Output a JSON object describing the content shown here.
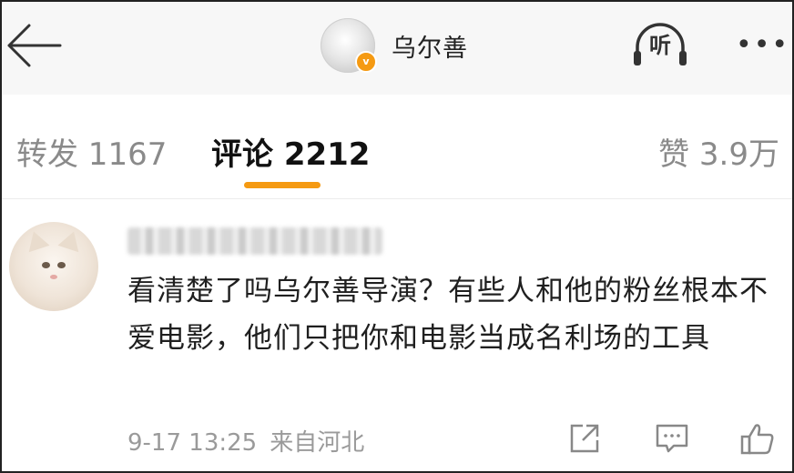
{
  "header": {
    "back_icon": "back-arrow-icon",
    "username": "乌尔善",
    "verified_badge": "v",
    "listen_label": "听",
    "more_label": "•••"
  },
  "tabs": [
    {
      "label": "转发 1167",
      "active": false
    },
    {
      "label": "评论 2212",
      "active": true
    },
    {
      "label": "赞 3.9万",
      "active": false
    }
  ],
  "comment": {
    "username": "▓▓▓▓ ▓▓▓▓▓▓",
    "text": "看清楚了吗乌尔善导演？有些人和他的粉丝根本不爱电影，他们只把你和电影当成名利场的工具",
    "time": "9-17 13:25",
    "location": "来自河北",
    "actions": [
      "share-icon",
      "reply-icon",
      "like-icon"
    ]
  },
  "colors": {
    "accent": "#f59a12",
    "muted": "#8a8a8a",
    "text": "#1f1f1f"
  }
}
